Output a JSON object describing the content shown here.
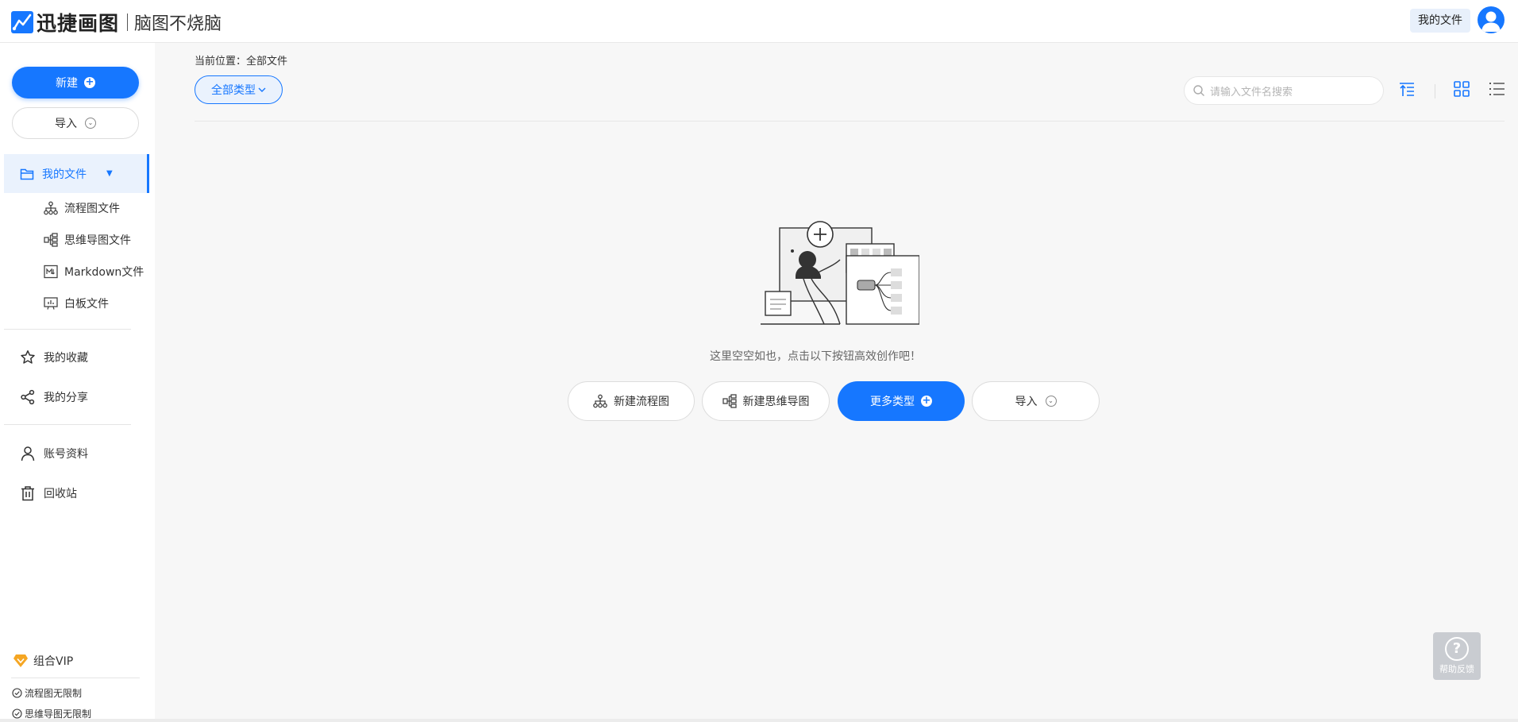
{
  "header": {
    "app_name": "迅捷画图",
    "slogan": "脑图不烧脑",
    "my_files": "我的文件"
  },
  "sidebar": {
    "new_button": "新建",
    "import_button": "导入",
    "my_files": "我的文件",
    "sub_items": [
      {
        "label": "流程图文件",
        "icon": "flowchart-icon"
      },
      {
        "label": "思维导图文件",
        "icon": "mindmap-icon"
      },
      {
        "label": "Markdown文件",
        "icon": "markdown-icon"
      },
      {
        "label": "白板文件",
        "icon": "whiteboard-icon"
      }
    ],
    "favorites": "我的收藏",
    "shares": "我的分享",
    "account": "账号资料",
    "recycle": "回收站",
    "vip": {
      "label": "组合VIP",
      "perks": [
        "流程图无限制",
        "思维导图无限制"
      ]
    }
  },
  "main": {
    "breadcrumb": "当前位置：全部文件",
    "type_filter": "全部类型",
    "search_placeholder": "请输入文件名搜索",
    "empty_message": "这里空空如也，点击以下按钮高效创作吧！",
    "actions": {
      "new_flowchart": "新建流程图",
      "new_mindmap": "新建思维导图",
      "more_types": "更多类型",
      "import": "导入"
    },
    "help": "帮助反馈"
  },
  "colors": {
    "accent": "#1677ff",
    "vip": "#f5a623",
    "background": "#f7f7f7"
  }
}
